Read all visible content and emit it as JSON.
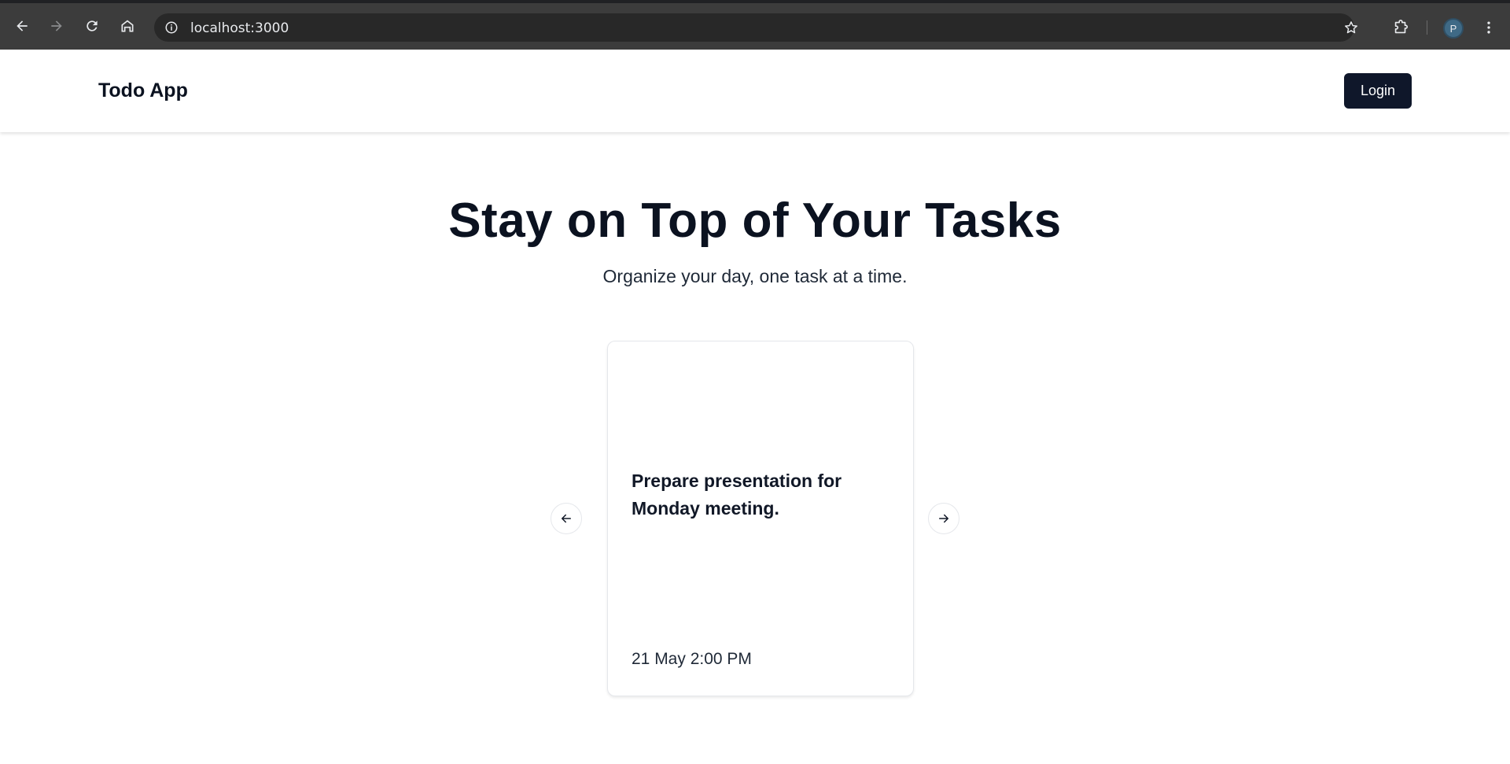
{
  "browser": {
    "url": "localhost:3000",
    "profile_initial": "P",
    "icons": {
      "back": "arrow-left-icon",
      "forward": "arrow-right-icon",
      "reload": "reload-icon",
      "home": "home-icon",
      "site_info": "info-icon",
      "bookmark": "star-icon",
      "extensions": "puzzle-icon",
      "menu": "kebab-menu-icon"
    }
  },
  "header": {
    "brand": "Todo App",
    "login_label": "Login"
  },
  "hero": {
    "title": "Stay on Top of Your Tasks",
    "subtitle": "Organize your day, one task at a time."
  },
  "carousel": {
    "task_text": "Prepare presentation for Monday meeting.",
    "task_time": "21 May 2:00 PM",
    "prev_icon": "arrow-left-icon",
    "next_icon": "arrow-right-icon"
  },
  "colors": {
    "primary": "#0f172a",
    "chrome_bg": "#3c3c3c",
    "omnibox_bg": "#282828"
  }
}
